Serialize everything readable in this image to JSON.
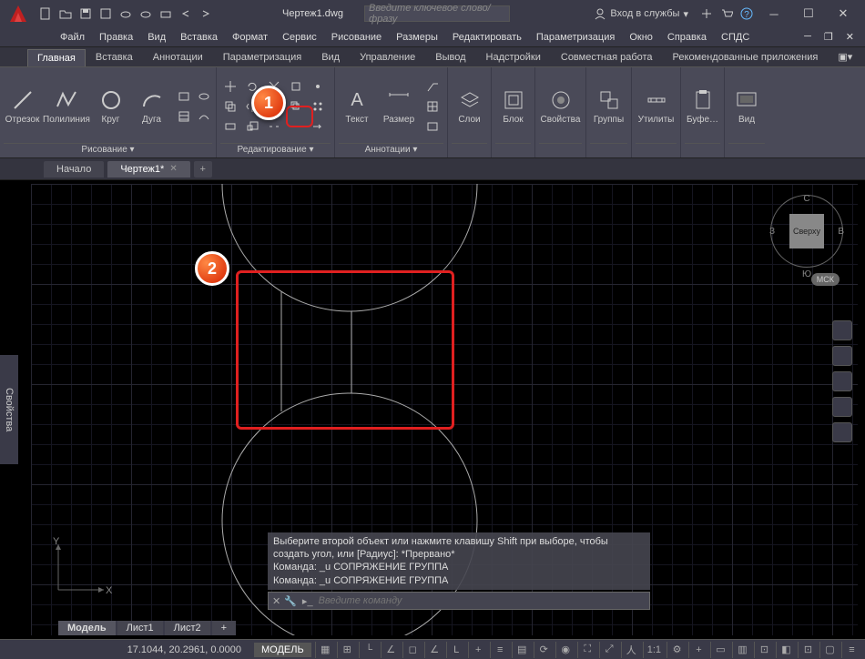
{
  "app_letter": "A",
  "title_doc": "Чертеж1.dwg",
  "search": {
    "placeholder": "Введите ключевое слово/фразу"
  },
  "signin_label": "Вход в службы",
  "menubar": [
    "Файл",
    "Правка",
    "Вид",
    "Вставка",
    "Формат",
    "Сервис",
    "Рисование",
    "Размеры",
    "Редактировать",
    "Параметризация",
    "Окно",
    "Справка",
    "СПДС"
  ],
  "ribbon_tabs": [
    "Главная",
    "Вставка",
    "Аннотации",
    "Параметризация",
    "Вид",
    "Управление",
    "Вывод",
    "Надстройки",
    "Совместная работа",
    "Рекомендованные приложения"
  ],
  "active_ribbon_tab": 0,
  "panels": {
    "draw": {
      "label": "Рисование ▾",
      "btns": [
        "Отрезок",
        "Полилиния",
        "Круг",
        "Дуга"
      ]
    },
    "modify": {
      "label": "Редактирование ▾"
    },
    "annot": {
      "label": "Аннотации ▾",
      "btns": [
        "Текст",
        "Размер"
      ]
    },
    "layers": {
      "label": "Слои"
    },
    "block": {
      "label": "Блок"
    },
    "props": {
      "label": "Свойства"
    },
    "groups": {
      "label": "Группы"
    },
    "utils": {
      "label": "Утилиты"
    },
    "clip": {
      "label": "Буфе…"
    },
    "view": {
      "label": "Вид"
    }
  },
  "doc_tabs": {
    "start": "Начало",
    "active": "Чертеж1*"
  },
  "props_panel": "Свойства",
  "viewcube": {
    "face": "Сверху",
    "n": "С",
    "s": "Ю",
    "w": "З",
    "e": "В",
    "wcs": "МСК"
  },
  "cmd": {
    "hist1": "Выберите второй объект или нажмите клавишу Shift при выборе, чтобы создать угол, или [Радиус]: *Прервано*",
    "hist2": "Команда: _u СОПРЯЖЕНИЕ ГРУППА",
    "hist3": "Команда: _u СОПРЯЖЕНИЕ ГРУППА",
    "placeholder": "Введите команду"
  },
  "layout_tabs": [
    "Модель",
    "Лист1",
    "Лист2"
  ],
  "status": {
    "coords": "17.1044, 20.2961, 0.0000",
    "model": "МОДЕЛЬ",
    "scale": "1:1"
  },
  "callouts": {
    "one": "1",
    "two": "2"
  }
}
